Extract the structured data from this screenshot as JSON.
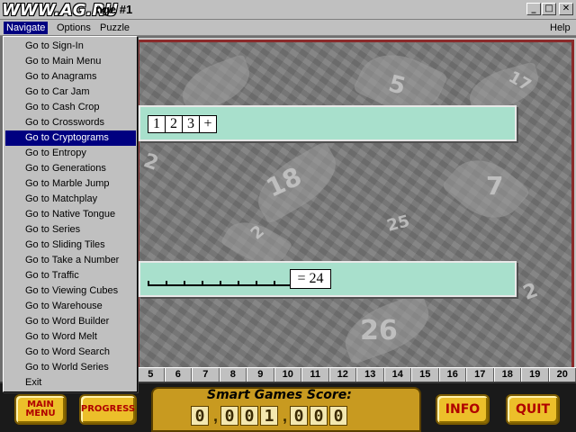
{
  "window": {
    "watermark": "WWW.AG.RU",
    "title": "nge #1",
    "controls": {
      "minimize": "_",
      "maximize": "□",
      "close": "✕"
    }
  },
  "menubar": {
    "items": [
      "Navigate",
      "Options",
      "Puzzle"
    ],
    "help": "Help"
  },
  "navigate_menu": {
    "items": [
      "Go to Sign-In",
      "Go to Main Menu",
      "Go to Anagrams",
      "Go to Car Jam",
      "Go to Cash Crop",
      "Go to Crosswords",
      "Go to Cryptograms",
      "Go to Entropy",
      "Go to Generations",
      "Go to Marble Jump",
      "Go to Matchplay",
      "Go to Native Tongue",
      "Go to Series",
      "Go to Sliding Tiles",
      "Go to Take a Number",
      "Go to Traffic",
      "Go to Viewing Cubes",
      "Go to Warehouse",
      "Go to Word Builder",
      "Go to Word Melt",
      "Go to Word Search",
      "Go to World Series",
      "Exit"
    ],
    "selected": "Go to Cryptograms"
  },
  "puzzle": {
    "tiles": [
      "1",
      "2",
      "3",
      "+"
    ],
    "result": "= 24",
    "background_numbers": [
      "5",
      "7",
      "18",
      "2",
      "26",
      "25",
      "2",
      "2",
      "17"
    ]
  },
  "levels": [
    "5",
    "6",
    "7",
    "8",
    "9",
    "10",
    "11",
    "12",
    "13",
    "14",
    "15",
    "16",
    "17",
    "18",
    "19",
    "20"
  ],
  "bottom": {
    "main_menu_label": "MAIN MENU",
    "progress_label": "PROGRESS",
    "score_title": "Smart Games Score:",
    "score_digits": [
      "0",
      "0",
      "0",
      "1",
      "0",
      "0",
      "0"
    ],
    "info_label": "INFO",
    "quit_label": "QUIT"
  },
  "colors": {
    "panel": "#a8e0cc",
    "menu_highlight": "#000080",
    "button_face": "#ecbf2a",
    "button_text": "#b00000"
  }
}
